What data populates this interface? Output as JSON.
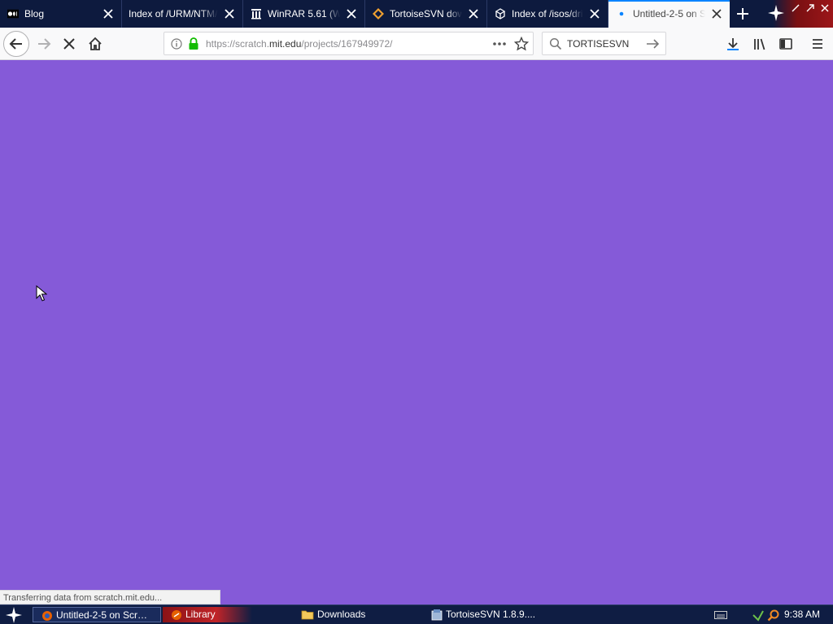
{
  "browser": {
    "tabs": [
      {
        "title": "Blog",
        "icon": "medium-icon"
      },
      {
        "title": "Index of /URM/NTM/Ga",
        "icon": "none"
      },
      {
        "title": "WinRAR 5.61 (Win",
        "icon": "archive-icon"
      },
      {
        "title": "TortoiseSVN downl",
        "icon": "tortoisesvn-icon"
      },
      {
        "title": "Index of /isos/driv",
        "icon": "server-icon"
      },
      {
        "title": "Untitled-2-5 on Sc",
        "icon": "loading-dot-icon",
        "active": true
      }
    ],
    "url": {
      "prefix": "https://scratch.",
      "host": "mit.edu",
      "path": "/projects/167949972/"
    },
    "search_value": "TORTISESVN",
    "status_text": "Transferring data from scratch.mit.edu..."
  },
  "page": {
    "background": "#855ad8"
  },
  "taskbar": {
    "items": [
      {
        "label": "Untitled-2-5 on Scr…",
        "icon": "firefox-icon"
      },
      {
        "label": "Library",
        "icon": "library-icon"
      },
      {
        "label": "Downloads",
        "icon": "folder-icon"
      },
      {
        "label": "TortoiseSVN 1.8.9....",
        "icon": "installer-icon"
      }
    ],
    "clock": "9:38 AM"
  },
  "colors": {
    "tabstrip": "#0d1a3e",
    "active_tab_line": "#0a84ff",
    "secure_lock": "#12bc00",
    "taskbar": "#0f1d43"
  }
}
